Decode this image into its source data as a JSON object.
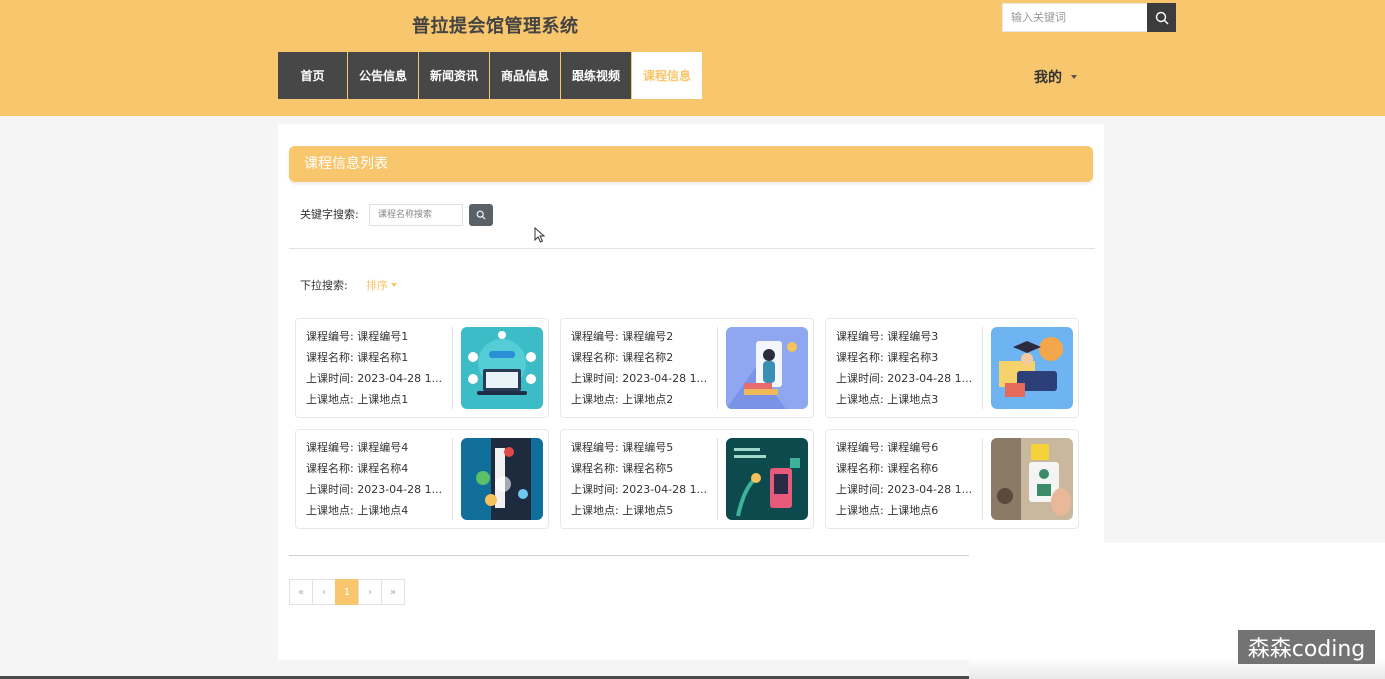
{
  "header": {
    "title": "普拉提会馆管理系统",
    "search_placeholder": "输入关键词",
    "mine_label": "我的"
  },
  "nav": {
    "home": "首页",
    "notice": "公告信息",
    "news": "新闻资讯",
    "goods": "商品信息",
    "video": "跟练视频",
    "course": "课程信息"
  },
  "list": {
    "title": "课程信息列表",
    "keyword_label": "关键字搜索:",
    "keyword_placeholder": "课程名称搜索",
    "dropdown_label": "下拉搜索:",
    "sort_label": "排序"
  },
  "cards": [
    {
      "no": "课程编号: 课程编号1",
      "name": "课程名称: 课程名称1",
      "time": "上课时间: 2023-04-28 1...",
      "place": "上课地点: 上课地点1"
    },
    {
      "no": "课程编号: 课程编号2",
      "name": "课程名称: 课程名称2",
      "time": "上课时间: 2023-04-28 1...",
      "place": "上课地点: 上课地点2"
    },
    {
      "no": "课程编号: 课程编号3",
      "name": "课程名称: 课程名称3",
      "time": "上课时间: 2023-04-28 1...",
      "place": "上课地点: 上课地点3"
    },
    {
      "no": "课程编号: 课程编号4",
      "name": "课程名称: 课程名称4",
      "time": "上课时间: 2023-04-28 1...",
      "place": "上课地点: 上课地点4"
    },
    {
      "no": "课程编号: 课程编号5",
      "name": "课程名称: 课程名称5",
      "time": "上课时间: 2023-04-28 1...",
      "place": "上课地点: 上课地点5"
    },
    {
      "no": "课程编号: 课程编号6",
      "name": "课程名称: 课程名称6",
      "time": "上课时间: 2023-04-28 1...",
      "place": "上课地点: 上课地点6"
    }
  ],
  "pagination": {
    "first": "«",
    "prev": "‹",
    "current": "1",
    "next": "›",
    "last": "»"
  },
  "watermark": "森森coding",
  "colors": {
    "accent": "#f8c66c",
    "nav_bg": "#474747",
    "search_btn": "#3c3c3c"
  }
}
